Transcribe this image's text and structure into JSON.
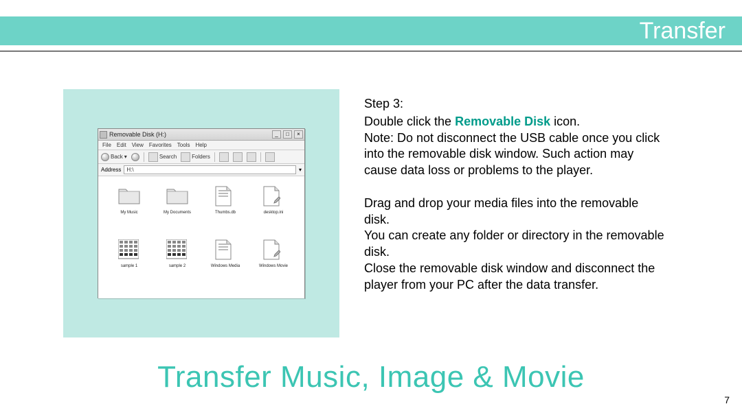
{
  "header": {
    "title": "Transfer"
  },
  "screenshot": {
    "window_title": "Removable Disk (H:)",
    "menu": {
      "file": "File",
      "edit": "Edit",
      "view": "View",
      "favorites": "Favorites",
      "tools": "Tools",
      "help": "Help"
    },
    "toolbar": {
      "back": "Back",
      "search": "Search",
      "folders": "Folders"
    },
    "address": {
      "label": "Address",
      "value": "H:\\"
    },
    "items": [
      {
        "label": "My Music",
        "type": "folder"
      },
      {
        "label": "My Documents",
        "type": "folder"
      },
      {
        "label": "Thumbs.db",
        "type": "doc"
      },
      {
        "label": "desktop.ini",
        "type": "doc-pencil"
      },
      {
        "label": "sample 1",
        "type": "grid"
      },
      {
        "label": "sample 2",
        "type": "grid"
      },
      {
        "label": "Windows Media",
        "type": "doc"
      },
      {
        "label": "Windows Movie",
        "type": "doc-pencil"
      }
    ]
  },
  "instructions": {
    "step_label": "Step 3:",
    "line1a": "Double click the ",
    "line1b": "Removable Disk",
    "line1c": " icon.",
    "note": "Note: Do not disconnect the USB cable once you click into the removable disk window. Such action may cause data loss or problems to the player.",
    "p2": "Drag and drop your media files into the removable disk.",
    "p3": "You can create any folder or directory in the removable disk.",
    "p4": "Close the removable disk window and disconnect the player from your PC after the data transfer."
  },
  "footer_title": "Transfer Music, Image & Movie",
  "page_number": "7"
}
